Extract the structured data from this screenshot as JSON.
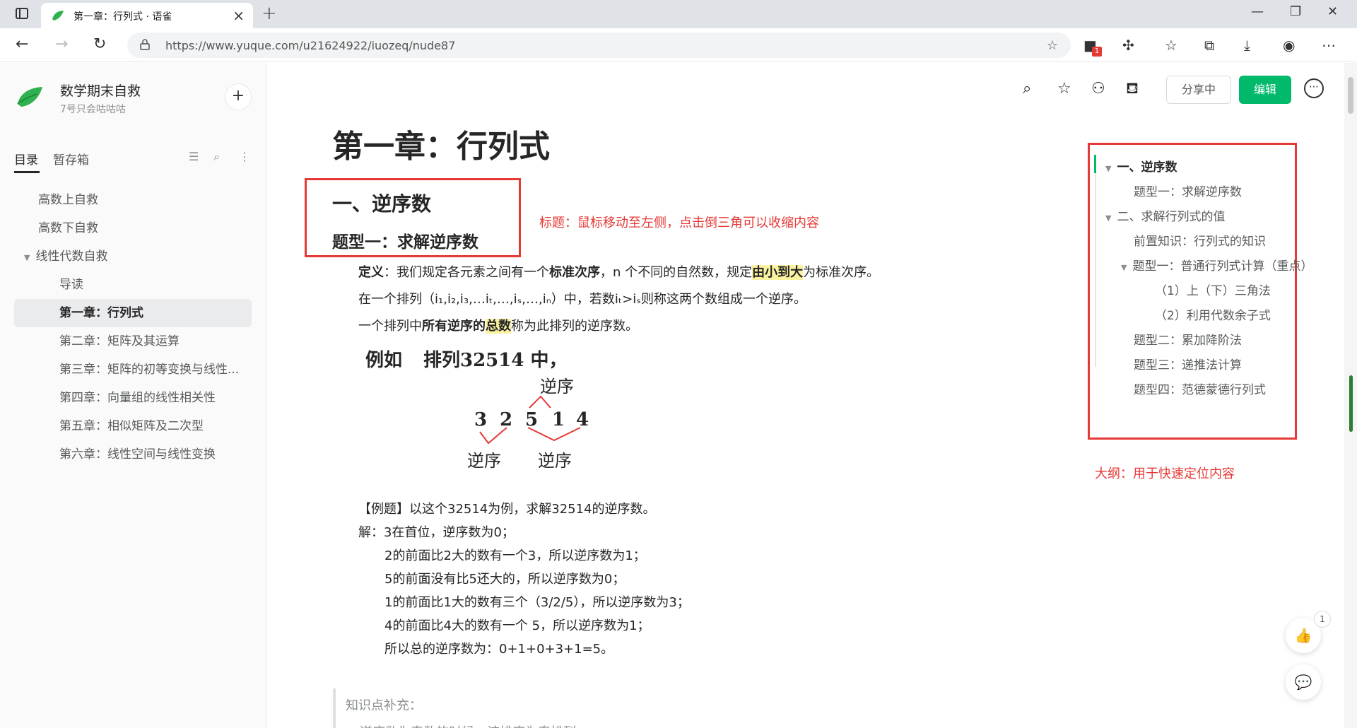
{
  "browser": {
    "tab_title": "第一章：行列式 · 语雀",
    "url": "https://www.yuque.com/u21624922/iuozeq/nude87",
    "ext_badge": "1"
  },
  "sidebar": {
    "brand_title": "数学期末自救",
    "brand_subtitle": "7号只会咕咕咕",
    "tabs": [
      "目录",
      "暂存箱"
    ],
    "items": [
      {
        "label": "高数上自救"
      },
      {
        "label": "高数下自救"
      },
      {
        "label": "线性代数自救"
      },
      {
        "label": "导读"
      },
      {
        "label": "第一章：行列式"
      },
      {
        "label": "第二章：矩阵及其运算"
      },
      {
        "label": "第三章：矩阵的初等变换与线性..."
      },
      {
        "label": "第四章：向量组的线性相关性"
      },
      {
        "label": "第五章：相似矩阵及二次型"
      },
      {
        "label": "第六章：线性空间与线性变换"
      }
    ]
  },
  "toolbar": {
    "share_label": "分享中",
    "edit_label": "编辑"
  },
  "doc": {
    "title": "第一章：行列式",
    "h2": "一、逆序数",
    "h3": "题型一：求解逆序数",
    "annotation_title": "标题：鼠标移动至左侧，点击倒三角可以收缩内容",
    "annotation_outline": "大纲：用于快速定位内容",
    "def_label": "定义",
    "def_text_1": "：我们规定各元素之间有一个",
    "def_bold_1": "标准次序",
    "def_text_2": "，n 个不同的自然数，规定",
    "def_hl": "由小到大",
    "def_text_3": "为标准次序。",
    "line2": "在一个排列（i₁,i₂,i₃,…iₜ,…,iₛ,…,iₙ）中，若数iₜ>iₛ则称这两个数组成一个逆序。",
    "line3_a": "一个排列中",
    "line3_b": "所有逆序的",
    "line3_hl": "总数",
    "line3_c": "称为此排列的逆序数。",
    "example_label": "例如",
    "example_text": "排列32514 中，",
    "example_reverse": "逆序",
    "example_digits": [
      "3",
      "2",
      "5",
      "1",
      "4"
    ],
    "problem": "【例题】以这个32514为例，求解32514的逆序数。",
    "solution_lines": [
      "解：3在首位，逆序数为0；",
      "2的前面比2大的数有一个3，所以逆序数为1；",
      "5的前面没有比5还大的，所以逆序数为0；",
      "1的前面比1大的数有三个（3/2/5），所以逆序数为3；",
      "4的前面比4大的数有一个 5，所以逆序数为1；",
      "所以总的逆序数为：0+1+0+3+1=5。"
    ],
    "quote_title": "知识点补充：",
    "quote_line": "逆序数为奇数的时候，该排序为奇排列"
  },
  "outline": {
    "items": [
      {
        "label": "一、逆序数"
      },
      {
        "label": "题型一：求解逆序数"
      },
      {
        "label": "二、求解行列式的值"
      },
      {
        "label": "前置知识：行列式的知识"
      },
      {
        "label": "题型一：普通行列式计算（重点）"
      },
      {
        "label": "（1）上（下）三角法"
      },
      {
        "label": "（2）利用代数余子式"
      },
      {
        "label": "题型二：累加降阶法"
      },
      {
        "label": "题型三：递推法计算"
      },
      {
        "label": "题型四：范德蒙德行列式"
      }
    ]
  },
  "like_count": "1",
  "colors": {
    "brand_green": "#00b96b",
    "annotation_red": "#e53935",
    "highlight_yellow": "#fbf3a0"
  }
}
